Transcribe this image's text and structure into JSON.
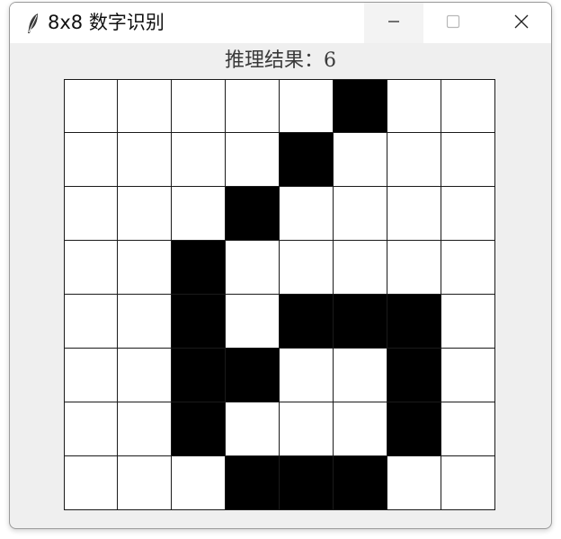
{
  "window": {
    "title": "8x8 数字识别",
    "app_icon": "feather-icon",
    "controls": {
      "minimize_icon": "minimize-icon",
      "maximize_icon": "maximize-icon",
      "close_icon": "close-icon"
    }
  },
  "result": {
    "text": "推理结果：6"
  },
  "canvas": {
    "rows": 8,
    "cols": 8,
    "filled_color": "#000000",
    "empty_color": "#ffffff",
    "pixels": [
      [
        0,
        0,
        0,
        0,
        0,
        1,
        0,
        0
      ],
      [
        0,
        0,
        0,
        0,
        1,
        0,
        0,
        0
      ],
      [
        0,
        0,
        0,
        1,
        0,
        0,
        0,
        0
      ],
      [
        0,
        0,
        1,
        0,
        0,
        0,
        0,
        0
      ],
      [
        0,
        0,
        1,
        0,
        1,
        1,
        1,
        0
      ],
      [
        0,
        0,
        1,
        1,
        0,
        0,
        1,
        0
      ],
      [
        0,
        0,
        1,
        0,
        0,
        0,
        1,
        0
      ],
      [
        0,
        0,
        0,
        1,
        1,
        1,
        0,
        0
      ]
    ]
  }
}
